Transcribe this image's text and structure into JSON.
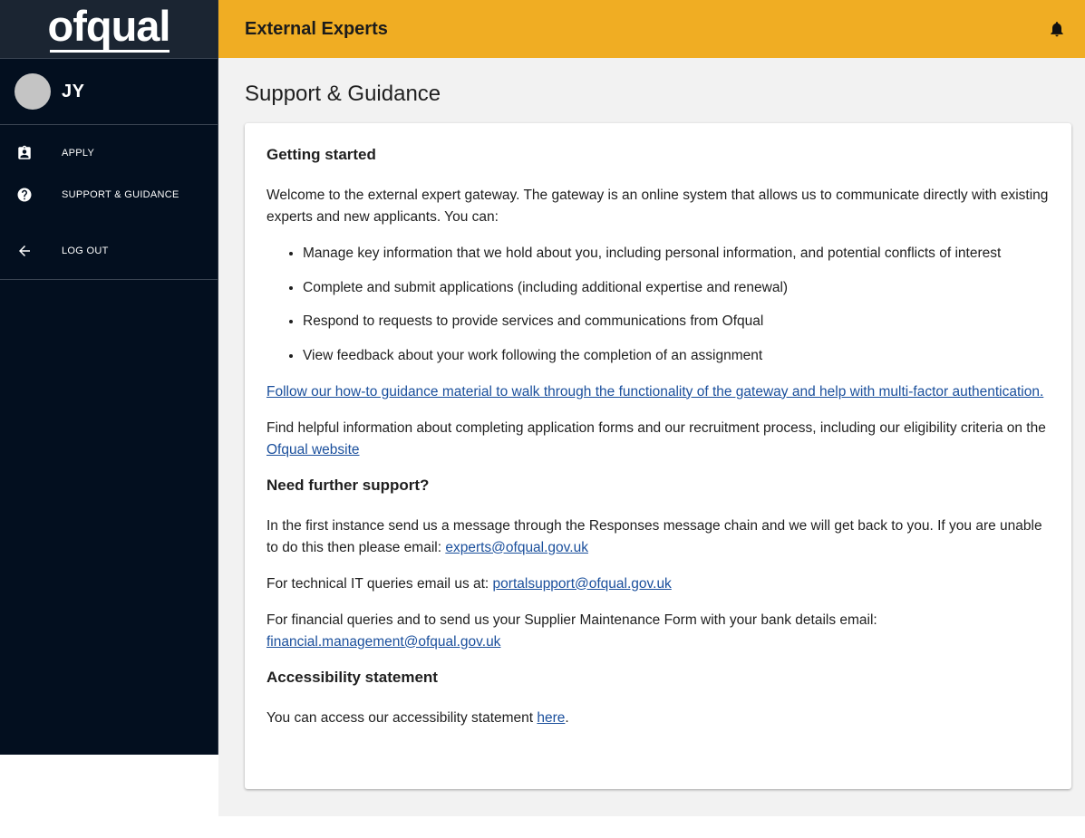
{
  "brand": {
    "logo_text": "ofqual"
  },
  "user": {
    "initials": "JY"
  },
  "nav": {
    "items": [
      {
        "label": "APPLY",
        "icon": "assignment-ind-icon"
      },
      {
        "label": "SUPPORT & GUIDANCE",
        "icon": "help-circle-icon"
      }
    ],
    "logout": {
      "label": "LOG OUT",
      "icon": "arrow-left-icon"
    }
  },
  "header": {
    "title": "External Experts",
    "notification_icon": "bell-icon"
  },
  "page": {
    "title": "Support & Guidance"
  },
  "getting_started": {
    "heading": "Getting started",
    "intro": "Welcome to the external expert gateway. The gateway is an online system that allows us to communicate directly with existing experts and new applicants. You can:",
    "bullets": [
      "Manage key information that we hold about you, including personal information, and potential conflicts of interest",
      "Complete and submit applications (including additional expertise and renewal)",
      "Respond to requests to provide services and communications from Ofqual",
      "View feedback about your work following the completion of an assignment"
    ],
    "guidance_link": "Follow our how-to guidance material to walk through the functionality of the gateway and help with multi-factor authentication.",
    "helpful_text": "Find helpful information about completing application forms and our recruitment process, including our eligibility criteria on the ",
    "helpful_link": "Ofqual website"
  },
  "further_support": {
    "heading": "Need further support?",
    "first_text": "In the first instance send us a message through the Responses message chain and we will get back to you. If you are unable to do this then please email: ",
    "first_email": "experts@ofqual.gov.uk",
    "it_text": "For technical IT queries email us at: ",
    "it_email": "portalsupport@ofqual.gov.uk",
    "finance_text": "For financial queries and to send us your Supplier Maintenance Form with your bank details email: ",
    "finance_email": "financial.management@ofqual.gov.uk"
  },
  "accessibility": {
    "heading": "Accessibility statement",
    "text": "You can access our accessibility statement ",
    "link": "here",
    "suffix": "."
  },
  "colors": {
    "sidebar_bg": "#030f1f",
    "header_bg": "#f0ad23",
    "link": "#1a4f9c",
    "main_bg": "#f2f2f2"
  }
}
